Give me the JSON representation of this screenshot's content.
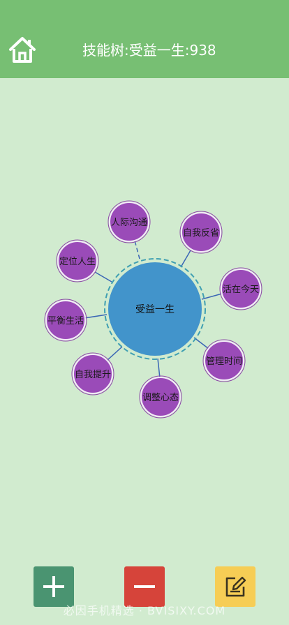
{
  "header": {
    "title": "技能树:受益一生:938",
    "home_icon": "home-icon"
  },
  "colors": {
    "header_bg": "#77bf73",
    "page_bg": "#d1ebcf",
    "center_node": "#4294cb",
    "skill_node": "#9a4bb8",
    "add_button": "#4a9471",
    "remove_button": "#d6443a",
    "edit_button": "#f6cd55"
  },
  "tree": {
    "center_label": "受益一生",
    "skills": [
      "人际沟通",
      "自我反省",
      "活在今天",
      "管理时间",
      "调整心态",
      "自我提升",
      "平衡生活",
      "定位人生"
    ]
  },
  "toolbar": {
    "add_icon": "plus-icon",
    "remove_icon": "minus-icon",
    "edit_icon": "edit-icon"
  },
  "watermark": "必因手机精选 · BVISIXY.COM"
}
